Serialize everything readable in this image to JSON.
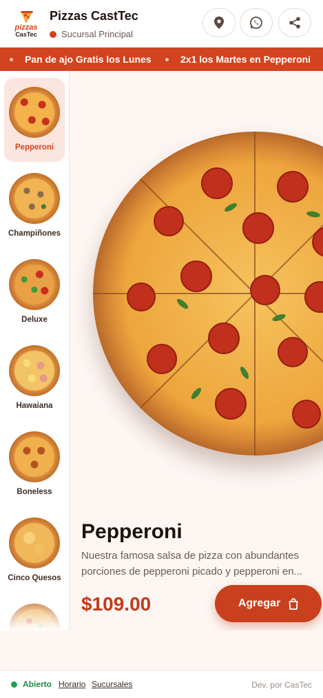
{
  "header": {
    "logo_text_top": "pizzas",
    "logo_text_bottom": "CasTec",
    "title": "Pizzas CastTec",
    "branch": "Sucursal Principal",
    "buttons": [
      {
        "icon": "map-pin-icon"
      },
      {
        "icon": "whatsapp-icon"
      },
      {
        "icon": "share-icon"
      }
    ]
  },
  "promo": {
    "items": [
      "Pan de ajo Gratis los Lunes",
      "2x1 los Martes en Pepperoni"
    ]
  },
  "categories": [
    {
      "label": "Pepperoni",
      "active": true
    },
    {
      "label": "Champiñones",
      "active": false
    },
    {
      "label": "Deluxe",
      "active": false
    },
    {
      "label": "Hawaiana",
      "active": false
    },
    {
      "label": "Boneless",
      "active": false
    },
    {
      "label": "Cinco Quesos",
      "active": false
    },
    {
      "label": "",
      "active": false
    }
  ],
  "product": {
    "name": "Pepperoni",
    "description": "Nuestra famosa salsa de pizza con abundantes porciones de pepperoni picado y pepperoni en...",
    "price": "$109.00",
    "add_label": "Agregar"
  },
  "footer": {
    "status": "Abierto",
    "links": [
      "Horario",
      "Sucursales"
    ],
    "credit": "Dev. por CasTec"
  },
  "colors": {
    "accent": "#d2431f",
    "button": "#c8401d",
    "price": "#c23a1a",
    "open": "#1f8a3f"
  }
}
